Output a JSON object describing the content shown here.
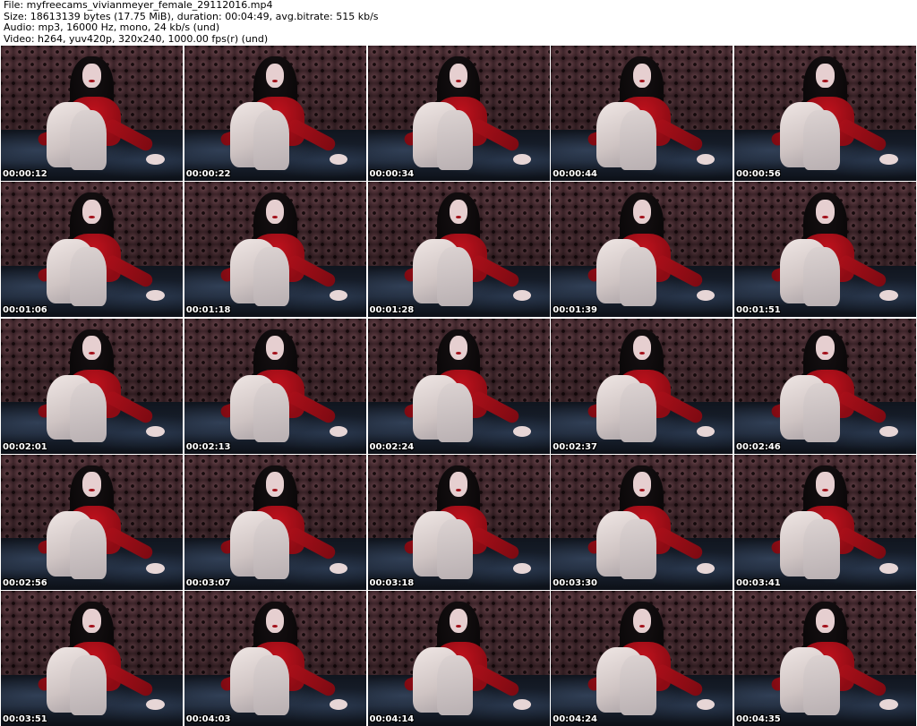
{
  "header": {
    "lines": [
      "File: myfreecams_vivianmeyer_female_29112016.mp4",
      "Size: 18613139 bytes (17.75 MiB), duration: 00:04:49, avg.bitrate: 515 kb/s",
      "Audio: mp3, 16000 Hz, mono, 24 kb/s (und)",
      "Video: h264, yuv420p, 320x240, 1000.00 fps(r) (und)"
    ]
  },
  "frames": [
    {
      "timestamp": "00:00:12"
    },
    {
      "timestamp": "00:00:22"
    },
    {
      "timestamp": "00:00:34"
    },
    {
      "timestamp": "00:00:44"
    },
    {
      "timestamp": "00:00:56"
    },
    {
      "timestamp": "00:01:06"
    },
    {
      "timestamp": "00:01:18"
    },
    {
      "timestamp": "00:01:28"
    },
    {
      "timestamp": "00:01:39"
    },
    {
      "timestamp": "00:01:51"
    },
    {
      "timestamp": "00:02:01"
    },
    {
      "timestamp": "00:02:13"
    },
    {
      "timestamp": "00:02:24"
    },
    {
      "timestamp": "00:02:37"
    },
    {
      "timestamp": "00:02:46"
    },
    {
      "timestamp": "00:02:56"
    },
    {
      "timestamp": "00:03:07"
    },
    {
      "timestamp": "00:03:18"
    },
    {
      "timestamp": "00:03:30"
    },
    {
      "timestamp": "00:03:41"
    },
    {
      "timestamp": "00:03:51"
    },
    {
      "timestamp": "00:04:03"
    },
    {
      "timestamp": "00:04:14"
    },
    {
      "timestamp": "00:04:24"
    },
    {
      "timestamp": "00:04:35"
    }
  ]
}
